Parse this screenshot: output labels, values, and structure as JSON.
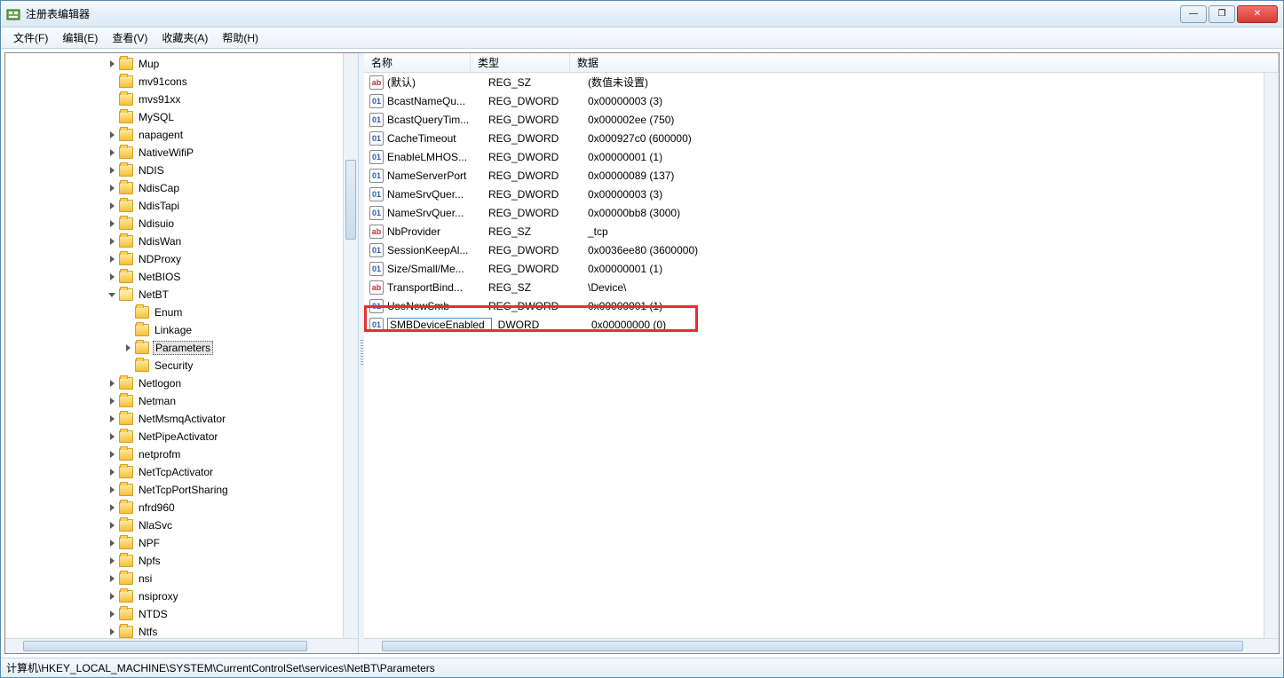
{
  "window": {
    "title": "注册表编辑器"
  },
  "menu": {
    "file": "文件(F)",
    "edit": "编辑(E)",
    "view": "查看(V)",
    "favorites": "收藏夹(A)",
    "help": "帮助(H)"
  },
  "columns": {
    "name": "名称",
    "type": "类型",
    "data": "数据"
  },
  "tree": [
    {
      "indent": 3,
      "exp": "tri",
      "label": "Mup"
    },
    {
      "indent": 3,
      "exp": "none",
      "label": "mv91cons"
    },
    {
      "indent": 3,
      "exp": "none",
      "label": "mvs91xx"
    },
    {
      "indent": 3,
      "exp": "none",
      "label": "MySQL"
    },
    {
      "indent": 3,
      "exp": "tri",
      "label": "napagent"
    },
    {
      "indent": 3,
      "exp": "tri",
      "label": "NativeWifiP"
    },
    {
      "indent": 3,
      "exp": "tri",
      "label": "NDIS"
    },
    {
      "indent": 3,
      "exp": "tri",
      "label": "NdisCap"
    },
    {
      "indent": 3,
      "exp": "tri",
      "label": "NdisTapi"
    },
    {
      "indent": 3,
      "exp": "tri",
      "label": "Ndisuio"
    },
    {
      "indent": 3,
      "exp": "tri",
      "label": "NdisWan"
    },
    {
      "indent": 3,
      "exp": "tri",
      "label": "NDProxy"
    },
    {
      "indent": 3,
      "exp": "tri",
      "label": "NetBIOS"
    },
    {
      "indent": 3,
      "exp": "open",
      "label": "NetBT",
      "open": true
    },
    {
      "indent": 4,
      "exp": "none",
      "label": "Enum"
    },
    {
      "indent": 4,
      "exp": "none",
      "label": "Linkage"
    },
    {
      "indent": 4,
      "exp": "tri",
      "label": "Parameters",
      "selected": true
    },
    {
      "indent": 4,
      "exp": "none",
      "label": "Security"
    },
    {
      "indent": 3,
      "exp": "tri",
      "label": "Netlogon"
    },
    {
      "indent": 3,
      "exp": "tri",
      "label": "Netman"
    },
    {
      "indent": 3,
      "exp": "tri",
      "label": "NetMsmqActivator"
    },
    {
      "indent": 3,
      "exp": "tri",
      "label": "NetPipeActivator"
    },
    {
      "indent": 3,
      "exp": "tri",
      "label": "netprofm"
    },
    {
      "indent": 3,
      "exp": "tri",
      "label": "NetTcpActivator"
    },
    {
      "indent": 3,
      "exp": "tri",
      "label": "NetTcpPortSharing"
    },
    {
      "indent": 3,
      "exp": "tri",
      "label": "nfrd960"
    },
    {
      "indent": 3,
      "exp": "tri",
      "label": "NlaSvc"
    },
    {
      "indent": 3,
      "exp": "tri",
      "label": "NPF"
    },
    {
      "indent": 3,
      "exp": "tri",
      "label": "Npfs"
    },
    {
      "indent": 3,
      "exp": "tri",
      "label": "nsi"
    },
    {
      "indent": 3,
      "exp": "tri",
      "label": "nsiproxy"
    },
    {
      "indent": 3,
      "exp": "tri",
      "label": "NTDS"
    },
    {
      "indent": 3,
      "exp": "tri",
      "label": "Ntfs"
    }
  ],
  "values": [
    {
      "icon": "sz",
      "name": "(默认)",
      "type": "REG_SZ",
      "data": "(数值未设置)"
    },
    {
      "icon": "dw",
      "name": "BcastNameQu...",
      "type": "REG_DWORD",
      "data": "0x00000003 (3)"
    },
    {
      "icon": "dw",
      "name": "BcastQueryTim...",
      "type": "REG_DWORD",
      "data": "0x000002ee (750)"
    },
    {
      "icon": "dw",
      "name": "CacheTimeout",
      "type": "REG_DWORD",
      "data": "0x000927c0 (600000)"
    },
    {
      "icon": "dw",
      "name": "EnableLMHOS...",
      "type": "REG_DWORD",
      "data": "0x00000001 (1)"
    },
    {
      "icon": "dw",
      "name": "NameServerPort",
      "type": "REG_DWORD",
      "data": "0x00000089 (137)"
    },
    {
      "icon": "dw",
      "name": "NameSrvQuer...",
      "type": "REG_DWORD",
      "data": "0x00000003 (3)"
    },
    {
      "icon": "dw",
      "name": "NameSrvQuer...",
      "type": "REG_DWORD",
      "data": "0x00000bb8 (3000)"
    },
    {
      "icon": "sz",
      "name": "NbProvider",
      "type": "REG_SZ",
      "data": "_tcp"
    },
    {
      "icon": "dw",
      "name": "SessionKeepAl...",
      "type": "REG_DWORD",
      "data": "0x0036ee80 (3600000)"
    },
    {
      "icon": "dw",
      "name": "Size/Small/Me...",
      "type": "REG_DWORD",
      "data": "0x00000001 (1)"
    },
    {
      "icon": "sz",
      "name": "TransportBind...",
      "type": "REG_SZ",
      "data": "\\Device\\"
    },
    {
      "icon": "dw",
      "name": "UseNewSmb",
      "type": "REG_DWORD",
      "data": "0x00000001 (1)"
    },
    {
      "icon": "dw",
      "name": "SMBDeviceEnabled",
      "type": "_DWORD",
      "data": "0x00000000 (0)",
      "editing": true,
      "highlight": true
    }
  ],
  "status": "计算机\\HKEY_LOCAL_MACHINE\\SYSTEM\\CurrentControlSet\\services\\NetBT\\Parameters"
}
